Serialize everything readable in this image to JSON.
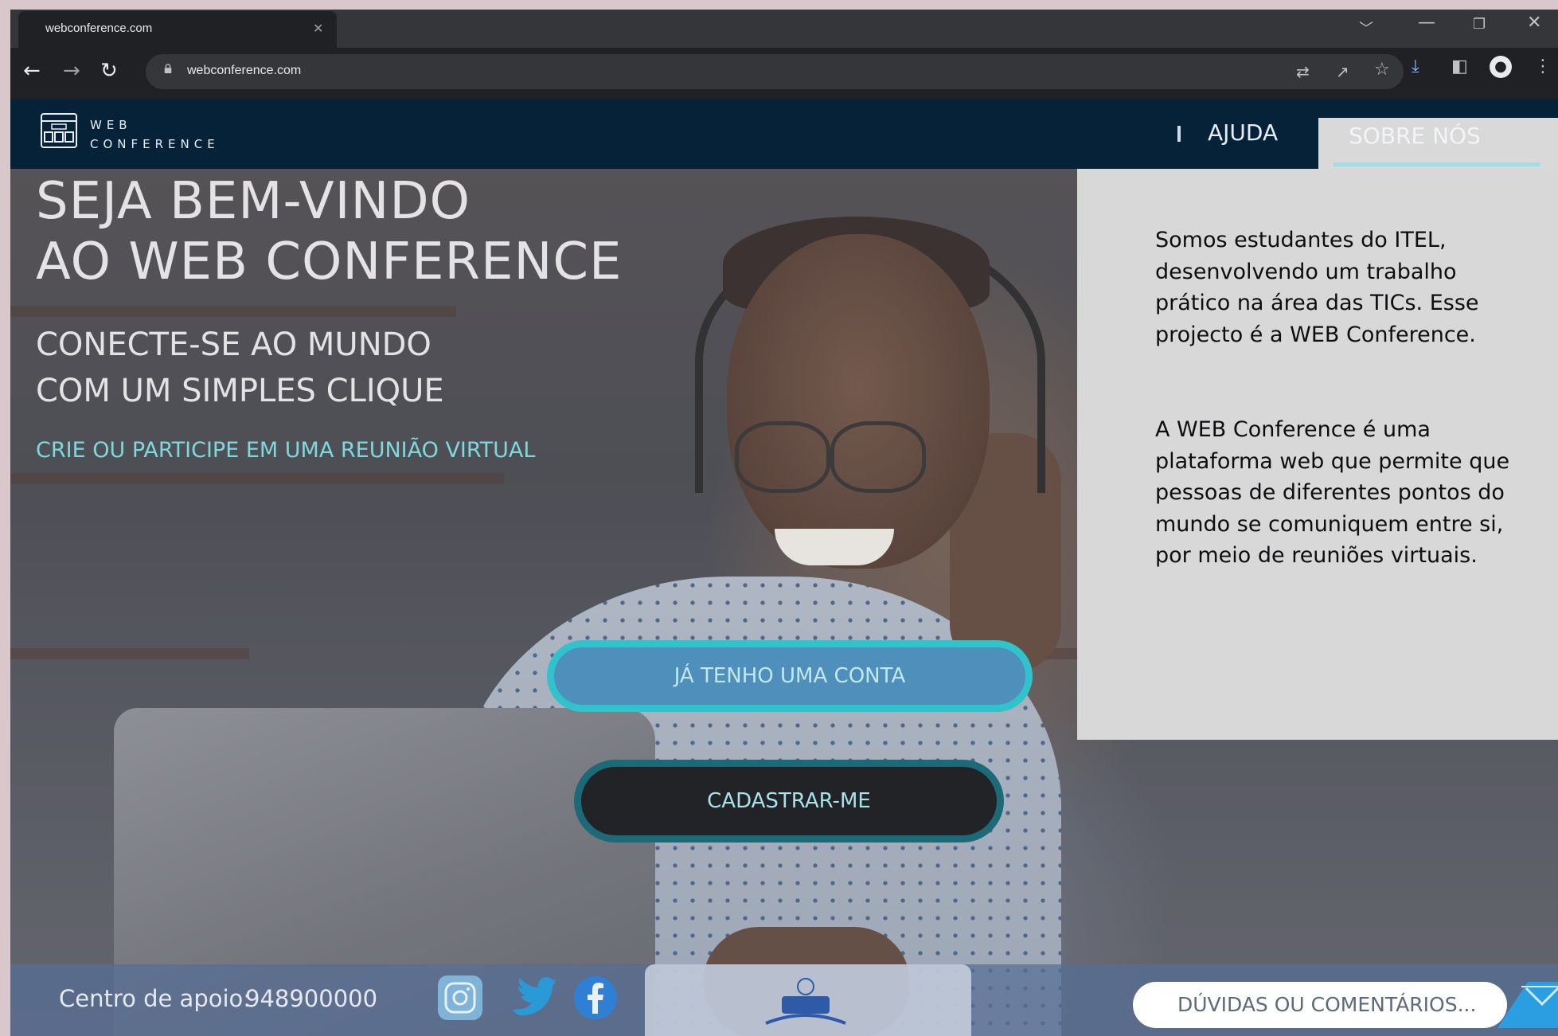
{
  "browser": {
    "tab_title": "webconference.com",
    "url": "webconference.com"
  },
  "site": {
    "logo_line1": "WEB",
    "logo_line2": "CONFERENCE",
    "nav": [
      {
        "label": "AJUDA"
      },
      {
        "label": "SOBRE NÓS",
        "active": true
      }
    ]
  },
  "hero": {
    "title_line1": "SEJA BEM-VINDO",
    "title_line2": "AO WEB CONFERENCE",
    "subtitle_line1": "CONECTE-SE AO MUNDO",
    "subtitle_line2": "COM UM SIMPLES CLIQUE",
    "tagline": "CRIE OU PARTICIPE  EM  UMA REUNIÃO VIRTUAL",
    "login_button": "JÁ TENHO UMA CONTA",
    "signup_button": "CADASTRAR-ME"
  },
  "about": {
    "paragraph1": "Somos estudantes do ITEL, desenvolvendo um trabalho prático na área das TICs. Esse projecto é a WEB Conference.",
    "paragraph2": "A WEB Conference é uma plataforma web que permite que pessoas de diferentes pontos do mundo se comuniquem entre si, por meio de reuniões virtuais."
  },
  "footer": {
    "support_label": "Centro de apoio:",
    "support_number": "948900000",
    "social_icons": [
      "instagram-icon",
      "twitter-icon",
      "facebook-icon"
    ],
    "feedback_placeholder": "DÚVIDAS OU COMENTÁRIOS..."
  },
  "colors": {
    "header_bg": "#062239",
    "accent_cyan": "#31c3cb",
    "login_fill": "#4f8fbb",
    "signup_fill": "#212326",
    "tagline": "#7fd8dc",
    "panel_bg": "#d8d8d9"
  }
}
